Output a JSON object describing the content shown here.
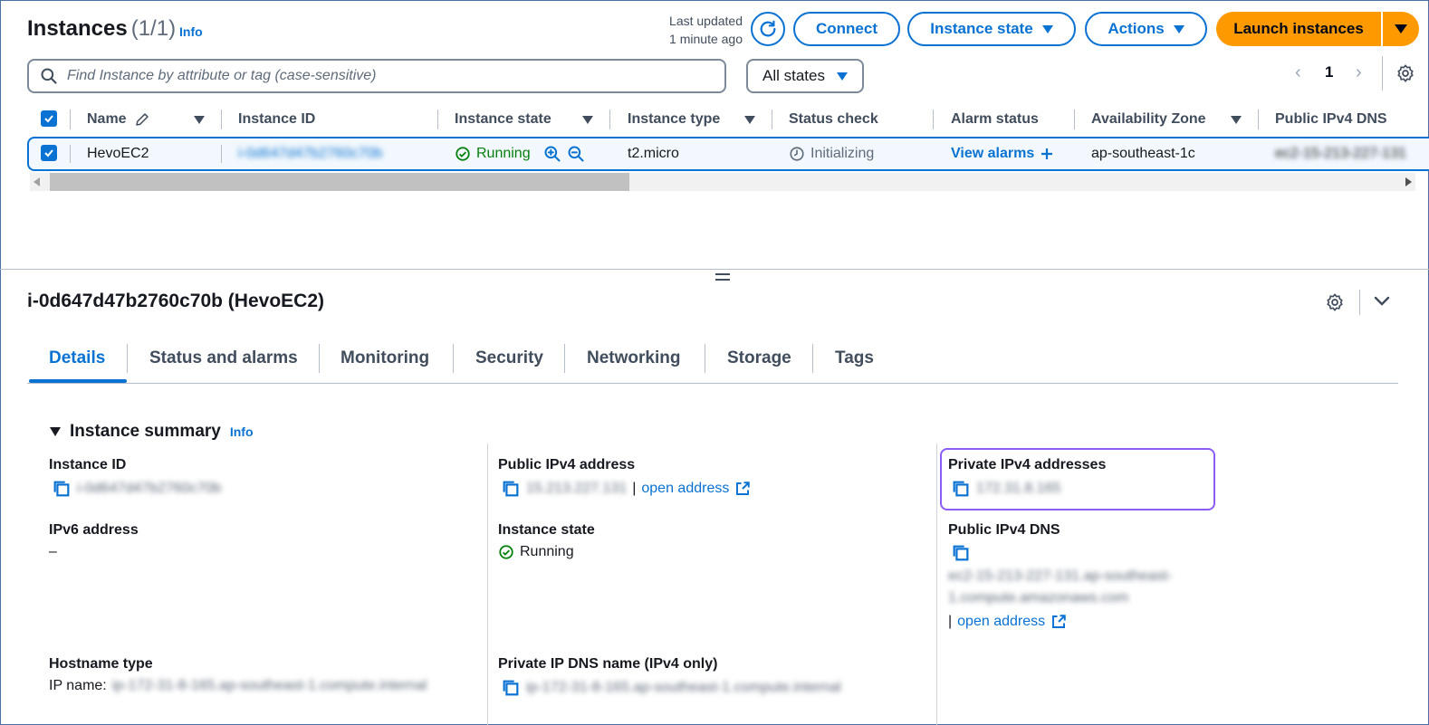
{
  "header": {
    "title": "Instances",
    "count": "(1/1)",
    "info": "Info",
    "last_updated_line1": "Last updated",
    "last_updated_line2": "1 minute ago",
    "connect": "Connect",
    "instance_state": "Instance state",
    "actions": "Actions",
    "launch": "Launch instances"
  },
  "filter": {
    "search_placeholder": "Find Instance by attribute or tag (case-sensitive)",
    "states": "All states",
    "page": "1"
  },
  "table": {
    "columns": [
      "Name",
      "Instance ID",
      "Instance state",
      "Instance type",
      "Status check",
      "Alarm status",
      "Availability Zone",
      "Public IPv4 DNS"
    ],
    "row": {
      "name": "HevoEC2",
      "instance_id": "i-0d647d47b2760c70b",
      "state": "Running",
      "type": "t2.micro",
      "status_check": "Initializing",
      "alarm": "View alarms",
      "az": "ap-southeast-1c",
      "public_dns": "ec2-15-213-227-131"
    }
  },
  "details": {
    "title": "i-0d647d47b2760c70b (HevoEC2)",
    "tabs": [
      "Details",
      "Status and alarms",
      "Monitoring",
      "Security",
      "Networking",
      "Storage",
      "Tags"
    ],
    "section_title": "Instance summary",
    "section_info": "Info",
    "instance_id_label": "Instance ID",
    "instance_id_value": "i-0d647d47b2760c70b",
    "ipv6_label": "IPv6 address",
    "ipv6_value": "–",
    "hostname_label": "Hostname type",
    "hostname_prefix": "IP name:",
    "hostname_value": "ip-172-31-8-165.ap-southeast-1.compute.internal",
    "public_ip_label": "Public IPv4 address",
    "public_ip_value": "15.213.227.131",
    "open_address": "open address",
    "state_label": "Instance state",
    "state_value": "Running",
    "private_dns_label": "Private IP DNS name (IPv4 only)",
    "private_dns_value": "ip-172-31-8-165.ap-southeast-1.compute.internal",
    "private_ip_label": "Private IPv4 addresses",
    "private_ip_value": "172.31.8.165",
    "public_dns_label": "Public IPv4 DNS",
    "public_dns_line1": "ec2-15-213-227-131.ap-southeast-",
    "public_dns_line2": "1.compute.amazonaws.com",
    "open_address_2": "open address"
  },
  "colors": {
    "accent": "#0972d3",
    "launch": "#ff9900",
    "running": "#037f0c",
    "focus": "#8b5cf6"
  }
}
